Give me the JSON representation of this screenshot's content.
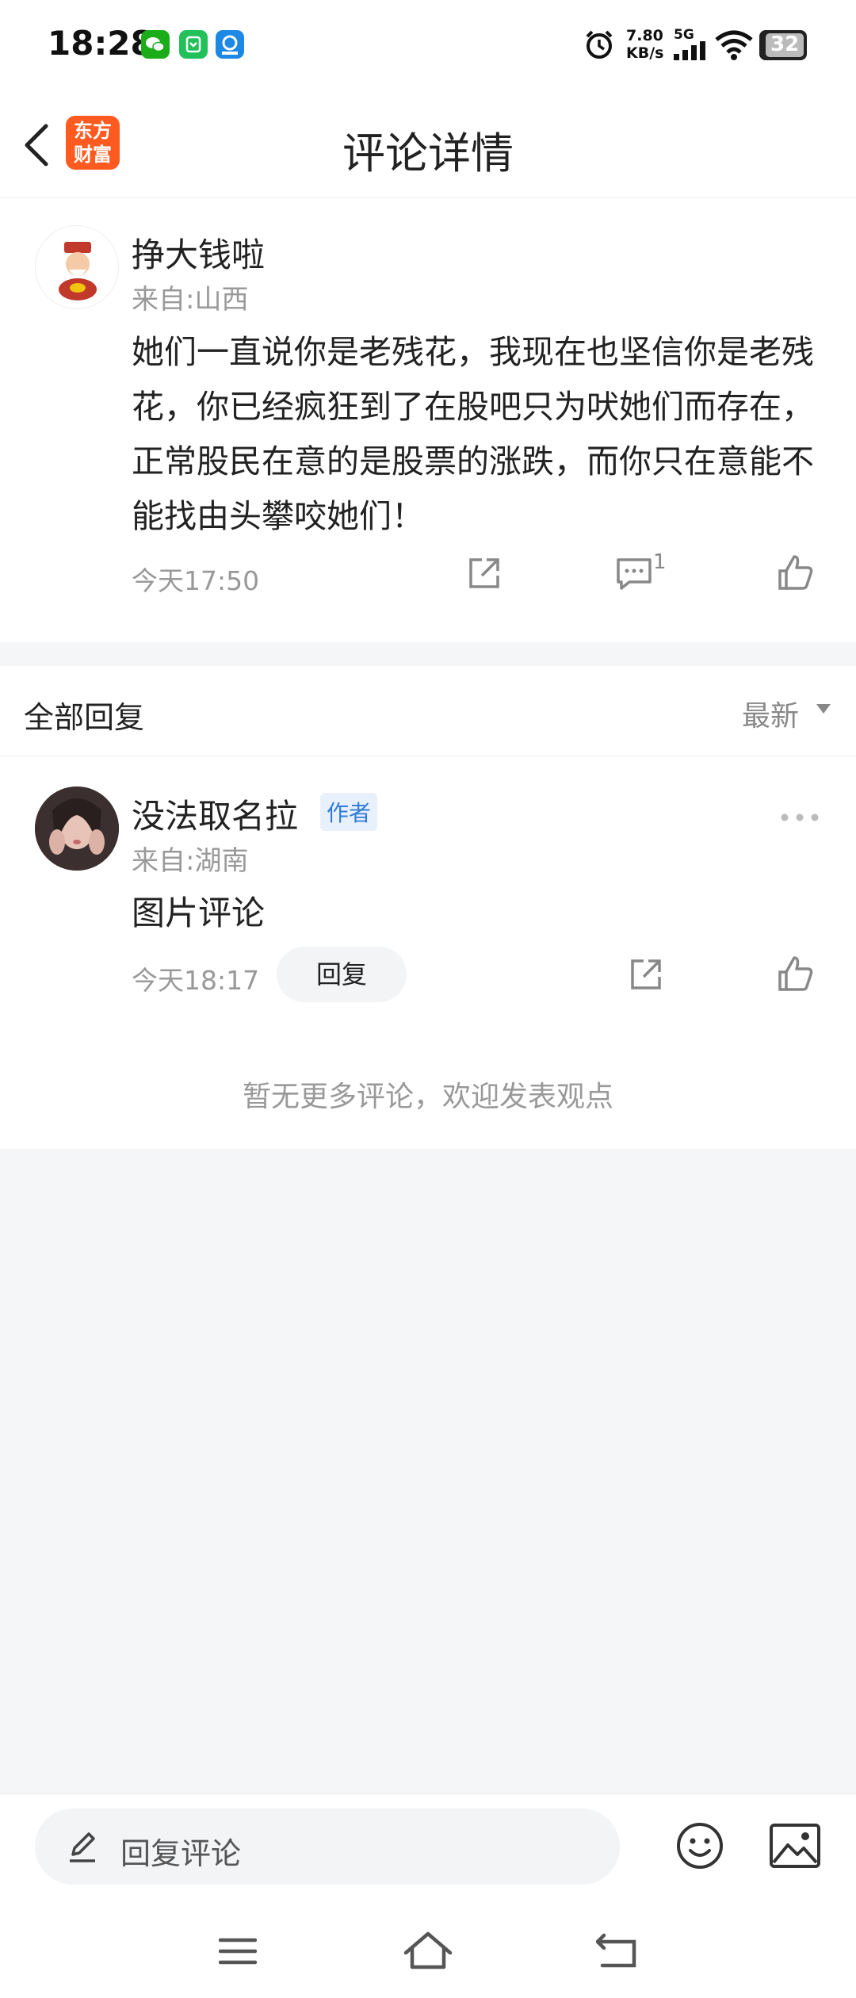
{
  "status_bar": {
    "time": "18:28",
    "net_speed": "7.80",
    "net_unit": "KB/s",
    "network": "5G",
    "battery": "32"
  },
  "header": {
    "back_icon": "chevron-left-icon",
    "logo_line1": "东方",
    "logo_line2": "财富",
    "title": "评论详情"
  },
  "comment": {
    "username": "挣大钱啦",
    "location": "来自:山西",
    "text": "她们一直说你是老残花，我现在也坚信你是老残花，你已经疯狂到了在股吧只为吠她们而存在，正常股民在意的是股票的涨跌，而你只在意能不能找由头攀咬她们！",
    "time": "今天17:50",
    "reply_count": "1"
  },
  "replies_header": {
    "label": "全部回复",
    "sort_label": "最新"
  },
  "reply": {
    "username": "没法取名拉",
    "badge": "作者",
    "location": "来自:湖南",
    "text": "图片评论",
    "time": "今天18:17",
    "reply_button": "回复"
  },
  "no_more_text": "暂无更多评论，欢迎发表观点",
  "bottom_bar": {
    "input_placeholder": "回复评论",
    "icons": [
      "pencil-icon",
      "emoji-icon",
      "image-icon"
    ]
  },
  "nav_icons": [
    "menu-icon",
    "home-icon",
    "back-icon"
  ],
  "colors": {
    "accent_orange": "#ff5a1f",
    "badge_blue": "#2f7bd9",
    "muted_text": "#999999"
  }
}
